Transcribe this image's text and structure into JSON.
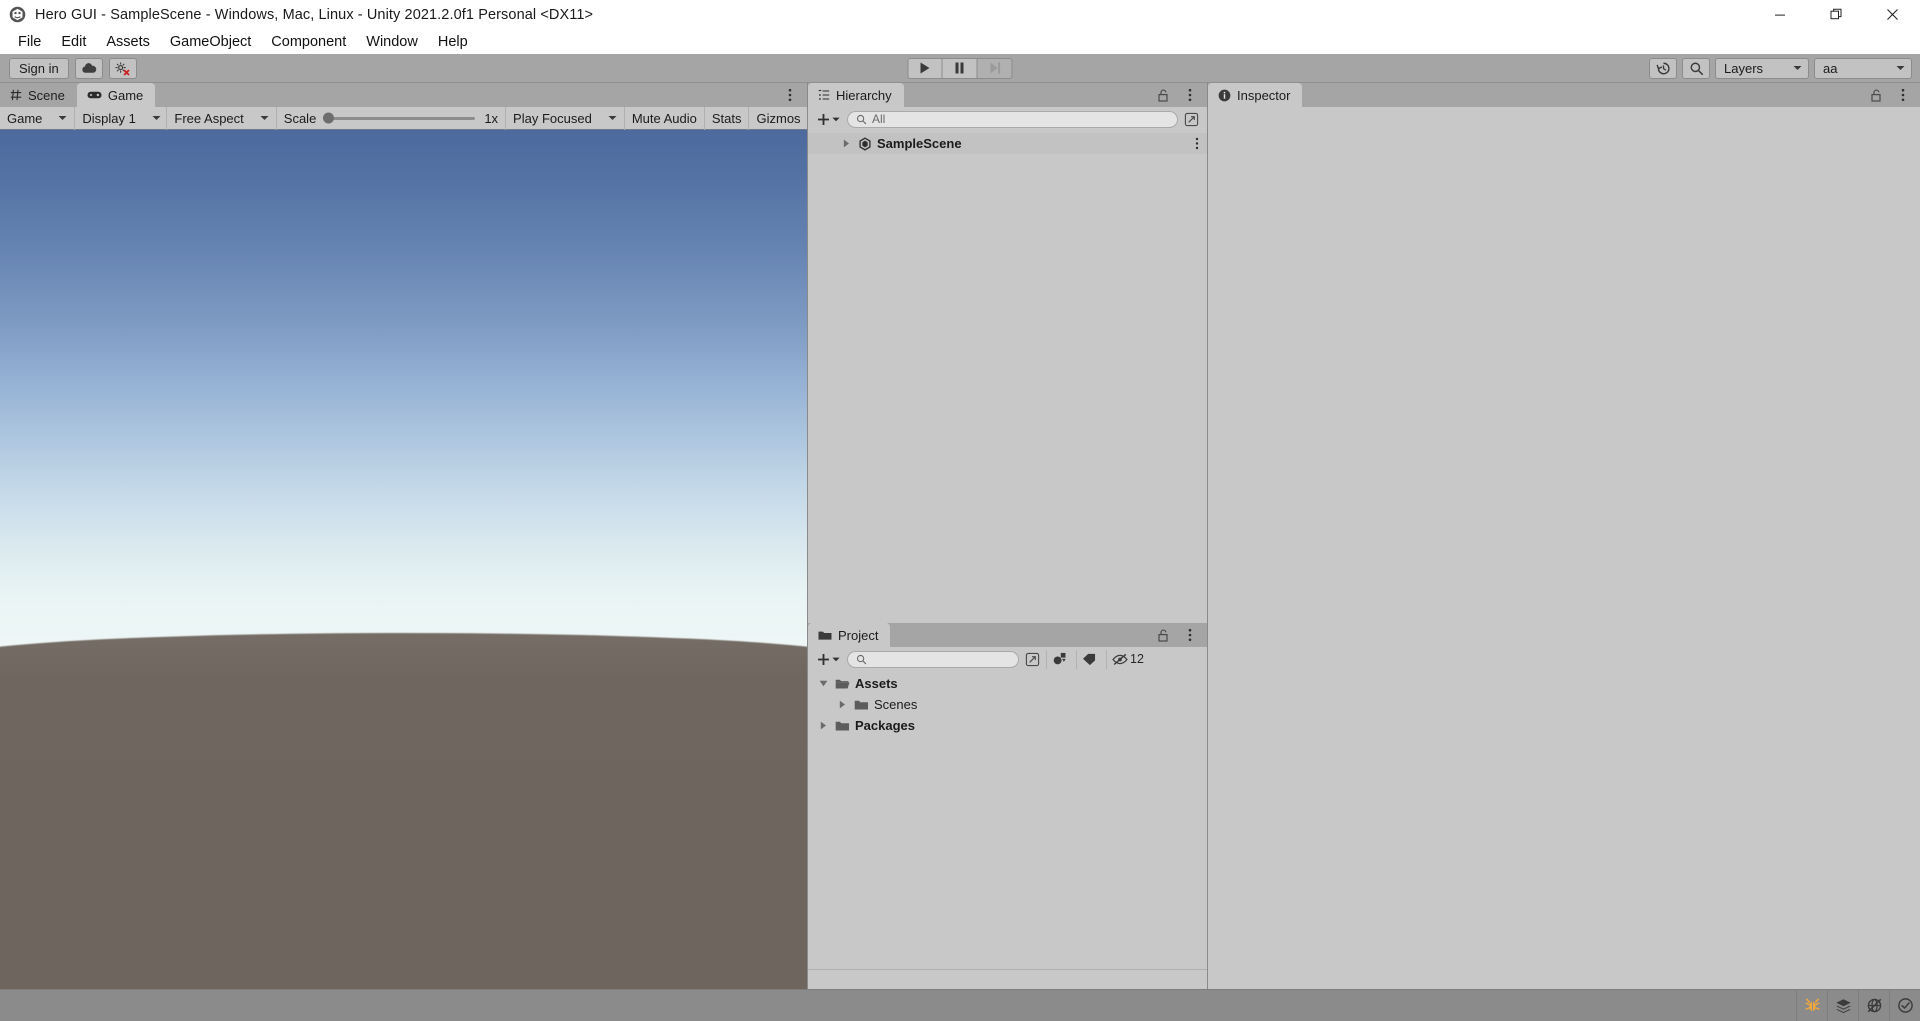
{
  "window": {
    "title": "Hero GUI - SampleScene - Windows, Mac, Linux - Unity 2021.2.0f1 Personal <DX11>",
    "app_icon": "unity-logo-icon",
    "controls": [
      {
        "name": "minimize",
        "icon": "minimize-icon"
      },
      {
        "name": "restore",
        "icon": "restore-icon"
      },
      {
        "name": "close",
        "icon": "close-icon"
      }
    ]
  },
  "menubar": {
    "items": [
      {
        "label": "File"
      },
      {
        "label": "Edit"
      },
      {
        "label": "Assets"
      },
      {
        "label": "GameObject"
      },
      {
        "label": "Component"
      },
      {
        "label": "Window"
      },
      {
        "label": "Help"
      }
    ]
  },
  "toolbar": {
    "signin_label": "Sign in",
    "cloud_icon": "cloud-icon",
    "services_icon": "collab-error-icon",
    "play_label": "play-icon",
    "pause_label": "pause-icon",
    "step_label": "step-icon",
    "history_icon": "undo-history-icon",
    "search_icon": "search-icon",
    "layers_label": "Layers",
    "layout_label": "aa"
  },
  "game_panel": {
    "tabs": [
      {
        "label": "Scene",
        "icon": "scene-grid-icon",
        "active": false
      },
      {
        "label": "Game",
        "icon": "gamepad-icon",
        "active": true
      }
    ],
    "kebab_icon": "kebab-menu-icon",
    "toolbar": {
      "target_display_mode": "Game",
      "display": "Display 1",
      "aspect": "Free Aspect",
      "scale_label": "Scale",
      "scale_value": "1x",
      "play_mode": "Play Focused",
      "mute_audio": "Mute Audio",
      "stats": "Stats",
      "gizmos": "Gizmos"
    }
  },
  "hierarchy": {
    "tab_label": "Hierarchy",
    "tab_icon": "hierarchy-list-icon",
    "lock_icon": "lock-open-icon",
    "kebab_icon": "kebab-menu-icon",
    "add_label": "plus-icon",
    "search_placeholder": "All",
    "search_value": "",
    "filter_icon": "search-popout-icon",
    "items": [
      {
        "label": "SampleScene",
        "icon": "unity-scene-icon",
        "expanded": false,
        "selected": true,
        "bold": true
      }
    ]
  },
  "project": {
    "tab_label": "Project",
    "tab_icon": "folder-icon",
    "lock_icon": "lock-open-icon",
    "kebab_icon": "kebab-menu-icon",
    "add_label": "plus-icon",
    "search_placeholder": "",
    "search_value": "",
    "filter_icon": "search-popout-icon",
    "type_filter_icon": "object-filter-icon",
    "label_filter_icon": "tag-icon",
    "hidden_packages_icon": "eye-off-icon",
    "hidden_packages_count": "12",
    "tree": [
      {
        "label": "Assets",
        "icon": "folder-open-icon",
        "expanded": true,
        "depth": 0,
        "bold": true
      },
      {
        "label": "Scenes",
        "icon": "folder-icon",
        "expanded": false,
        "depth": 1,
        "bold": false
      },
      {
        "label": "Packages",
        "icon": "folder-icon",
        "expanded": false,
        "depth": 0,
        "bold": true
      }
    ]
  },
  "inspector": {
    "tab_label": "Inspector",
    "tab_icon": "info-icon",
    "lock_icon": "lock-open-icon",
    "kebab_icon": "kebab-menu-icon"
  },
  "statusbar": {
    "icons": [
      {
        "name": "code-optimization-icon",
        "color": "#f2a83b"
      },
      {
        "name": "asset-database-icon",
        "color": "#3b3b3b"
      },
      {
        "name": "gizmos-off-icon",
        "color": "#3b3b3b"
      },
      {
        "name": "status-ok-icon",
        "color": "#3b3b3b"
      }
    ]
  },
  "colors": {
    "toolbar_bg": "#a5a5a5",
    "panel_bg": "#c8c8c8",
    "statusbar_bg": "#8b8b8b",
    "sky_top": "#4c6a9d",
    "sky_horizon": "#eef7f6",
    "ground": "#6e655e"
  }
}
